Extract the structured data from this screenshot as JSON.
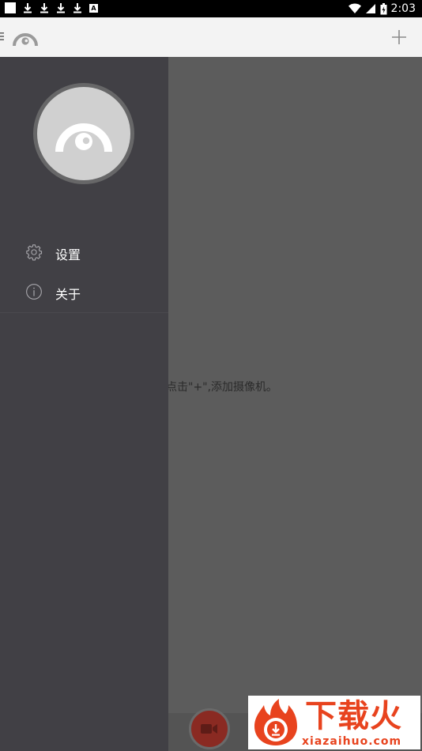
{
  "status_bar": {
    "time": "2:03",
    "notification_badge": "A"
  },
  "app_bar": {
    "add_label": "+"
  },
  "main": {
    "empty_hint": "点击\"+\",添加摄像机。"
  },
  "drawer": {
    "items": [
      {
        "label": "设置",
        "icon": "gear-icon"
      },
      {
        "label": "关于",
        "icon": "info-icon"
      }
    ]
  },
  "watermark": {
    "title": "下载火",
    "subtitle": "xiazaihuo.com"
  },
  "colors": {
    "drawer_bg": "#414045",
    "appbar_bg": "#f3f3f3",
    "scrim": "#5c5c5c",
    "fab": "#8a2a22",
    "watermark": "#e8431e"
  }
}
